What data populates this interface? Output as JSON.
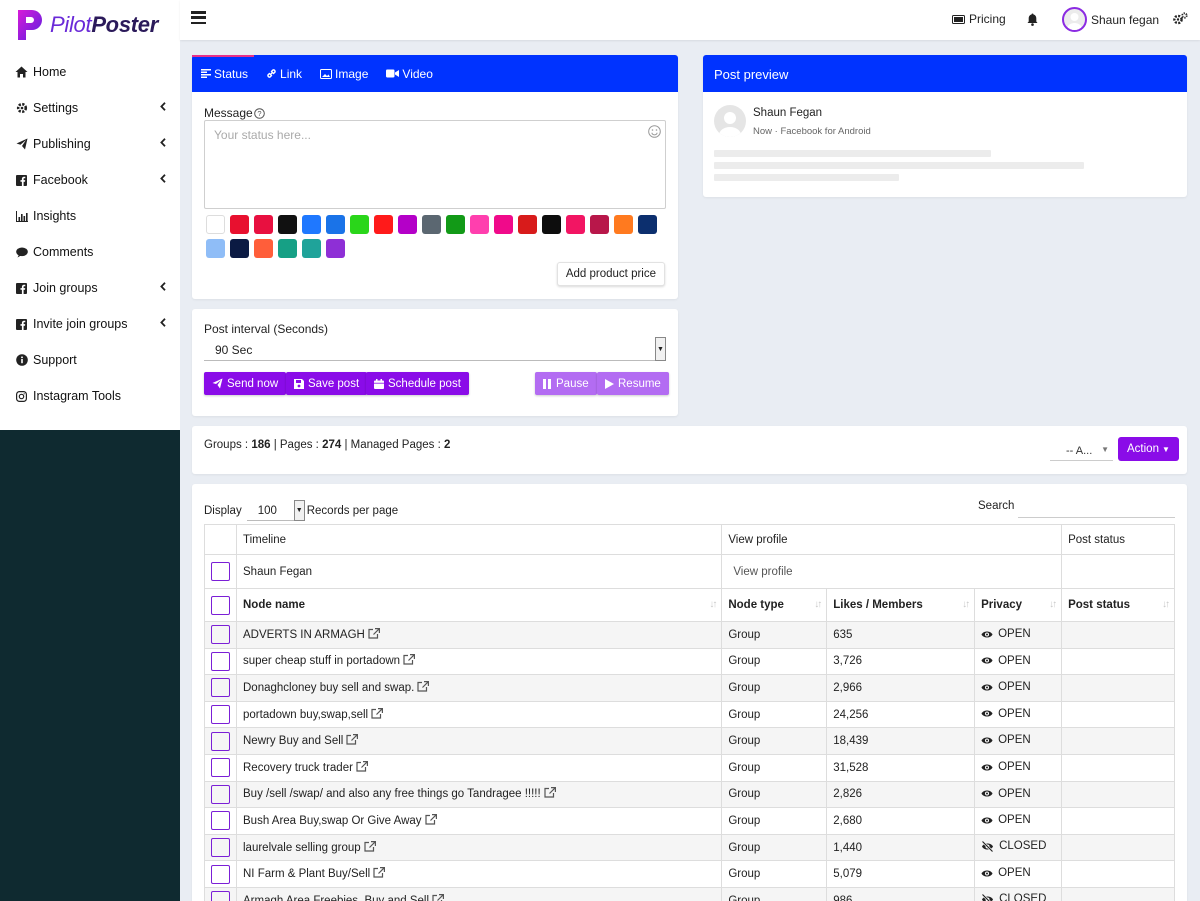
{
  "brand": {
    "name_a": "Pilot",
    "name_b": "Poster"
  },
  "topbar": {
    "pricing": "Pricing",
    "user_name": "Shaun fegan"
  },
  "sidebar": {
    "items": [
      {
        "label": "Home",
        "icon": "home-icon",
        "chev": false
      },
      {
        "label": "Settings",
        "icon": "gear-icon",
        "chev": true
      },
      {
        "label": "Publishing",
        "icon": "paper-plane-icon",
        "chev": true
      },
      {
        "label": "Facebook",
        "icon": "facebook-icon",
        "chev": true
      },
      {
        "label": "Insights",
        "icon": "chart-icon",
        "chev": false
      },
      {
        "label": "Comments",
        "icon": "comment-icon",
        "chev": false
      },
      {
        "label": "Join groups",
        "icon": "facebook-icon",
        "chev": true
      },
      {
        "label": "Invite join groups",
        "icon": "facebook-icon",
        "chev": true
      },
      {
        "label": "Support",
        "icon": "info-icon",
        "chev": false
      },
      {
        "label": "Instagram Tools",
        "icon": "instagram-icon",
        "chev": false
      }
    ]
  },
  "composer": {
    "tabs": [
      "Status",
      "Link",
      "Image",
      "Video"
    ],
    "message_label": "Message",
    "placeholder": "Your status here...",
    "add_product_price": "Add product price",
    "swatches": [
      "#ffffff",
      "#e8102f",
      "#e81040",
      "#111111",
      "#1f78ff",
      "#1a73e8",
      "#2ad61a",
      "#ff1a1a",
      "#b400c8",
      "#5b6771",
      "#129a17",
      "#ff3fae",
      "#f00a8a",
      "#d81b1b",
      "#0d0d0d",
      "#f21563",
      "#b8174a",
      "#ff7a1f",
      "#0c2f6e",
      "#8fbdf7",
      "#0b1a43",
      "#ff5e3a",
      "#16a085",
      "#1fa39a",
      "#8e2fd6"
    ]
  },
  "interval": {
    "label": "Post interval (Seconds)",
    "value": "90 Sec",
    "send_now": "Send now",
    "save_post": "Save post",
    "schedule_post": "Schedule post",
    "pause": "Pause",
    "resume": "Resume"
  },
  "preview": {
    "title": "Post preview",
    "name": "Shaun Fegan",
    "sub": "Now · Facebook for Android"
  },
  "stats": {
    "groups_label": "Groups : ",
    "groups": "186",
    "pages_label": " | Pages : ",
    "pages": "274",
    "managed_label": " | Managed Pages : ",
    "managed": "2",
    "filter": "-- A...",
    "action": "Action"
  },
  "table": {
    "display_label": "Display",
    "display_value": "100",
    "records_label": "Records per page",
    "search_label": "Search",
    "header1": [
      "Timeline",
      "View profile",
      "Post status"
    ],
    "timeline_row": {
      "name": "Shaun Fegan",
      "view": "View profile"
    },
    "header2": [
      "Node name",
      "Node type",
      "Likes / Members",
      "Privacy",
      "Post status"
    ],
    "rows": [
      {
        "name": "ADVERTS IN ARMAGH",
        "type": "Group",
        "members": "635",
        "privacy": "OPEN"
      },
      {
        "name": "super cheap stuff in portadown",
        "type": "Group",
        "members": "3,726",
        "privacy": "OPEN"
      },
      {
        "name": "Donaghcloney buy sell and swap.",
        "type": "Group",
        "members": "2,966",
        "privacy": "OPEN"
      },
      {
        "name": "portadown buy,swap,sell",
        "type": "Group",
        "members": "24,256",
        "privacy": "OPEN"
      },
      {
        "name": "Newry Buy and Sell",
        "type": "Group",
        "members": "18,439",
        "privacy": "OPEN"
      },
      {
        "name": "Recovery truck trader",
        "type": "Group",
        "members": "31,528",
        "privacy": "OPEN"
      },
      {
        "name": "Buy /sell /swap/ and also any free things go Tandragee !!!!!",
        "type": "Group",
        "members": "2,826",
        "privacy": "OPEN"
      },
      {
        "name": "Bush Area Buy,swap Or Give Away",
        "type": "Group",
        "members": "2,680",
        "privacy": "OPEN"
      },
      {
        "name": "laurelvale selling group",
        "type": "Group",
        "members": "1,440",
        "privacy": "CLOSED"
      },
      {
        "name": "NI Farm & Plant Buy/Sell",
        "type": "Group",
        "members": "5,079",
        "privacy": "OPEN"
      },
      {
        "name": "Armagh Area Freebies, Buy and Sell",
        "type": "Group",
        "members": "986",
        "privacy": "CLOSED"
      }
    ]
  },
  "colors": {
    "accent": "#0033ff",
    "purple": "#8a0ce8",
    "sidebar_dark": "#0f2a30"
  }
}
